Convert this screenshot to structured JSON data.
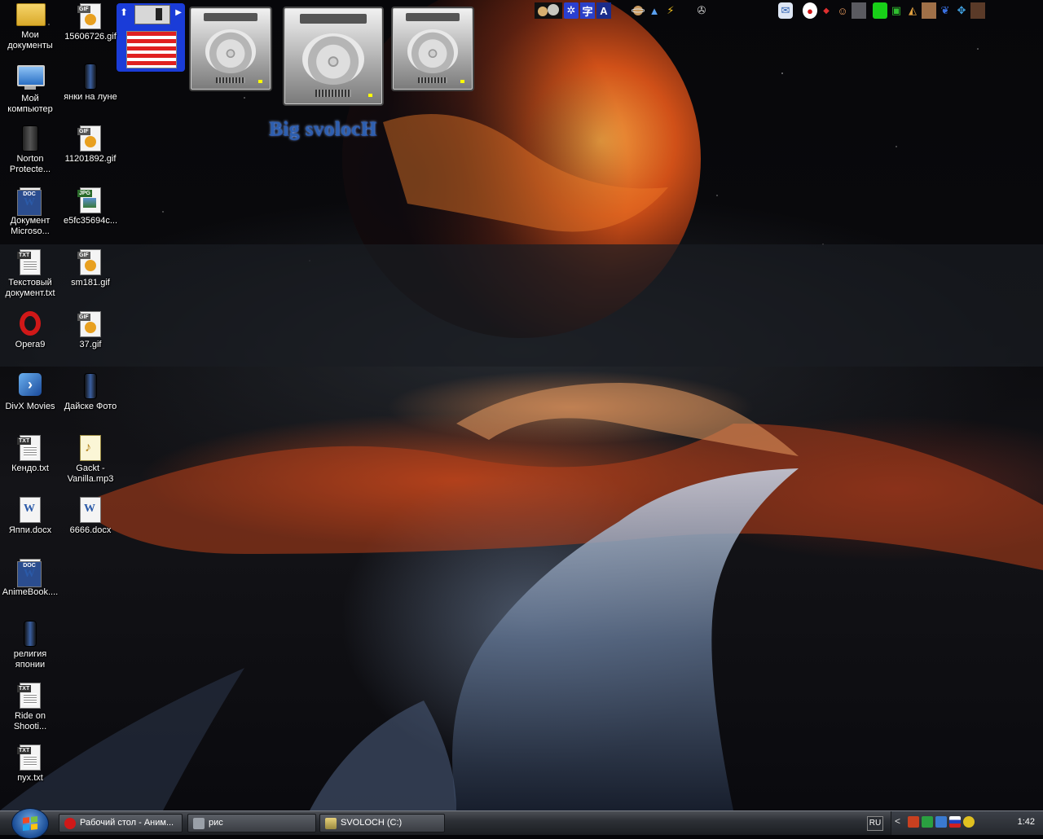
{
  "desktop": {
    "overlay_text": "Big svolocH",
    "column1": [
      {
        "id": "my-documents",
        "label": "Мои документы"
      },
      {
        "id": "my-computer",
        "label": "Мой компьютер"
      },
      {
        "id": "norton",
        "label": "Norton Protecte..."
      },
      {
        "id": "doc-microsoft",
        "label": "Документ Microso..."
      },
      {
        "id": "text-doc",
        "label": "Текстовый документ.txt"
      },
      {
        "id": "opera",
        "label": "Opera9"
      },
      {
        "id": "divx",
        "label": "DivX Movies"
      },
      {
        "id": "kendo",
        "label": "Кендо.txt"
      },
      {
        "id": "yappi",
        "label": "Яппи.docx"
      },
      {
        "id": "animebook",
        "label": "AnimeBook...."
      },
      {
        "id": "religion",
        "label": "религия японии"
      },
      {
        "id": "ride-on",
        "label": "Ride on Shooti..."
      },
      {
        "id": "pukh",
        "label": "пух.txt"
      }
    ],
    "column2": [
      {
        "id": "gif-15606726",
        "label": "15606726.gif"
      },
      {
        "id": "yanki",
        "label": "янки на луне"
      },
      {
        "id": "gif-11201892",
        "label": "11201892.gif"
      },
      {
        "id": "jpg-e5fc",
        "label": "e5fc35694c..."
      },
      {
        "id": "gif-sm181",
        "label": "sm181.gif"
      },
      {
        "id": "gif-37",
        "label": "37.gif"
      },
      {
        "id": "daiske",
        "label": "Дайске Фото"
      },
      {
        "id": "gackt",
        "label": "Gackt - Vanilla.mp3"
      },
      {
        "id": "docx-6666",
        "label": "6666.docx"
      }
    ],
    "top_tray_icon_names_left": [
      "planets-icon",
      "globe-icon",
      "kanji-icon",
      "translate-icon",
      "planet-icon",
      "triangle-icon",
      "flash-icon",
      "film-icon"
    ],
    "top_tray_icon_names_right": [
      "mail-icon",
      "red-circle-icon",
      "120-icon",
      "people-icon",
      "grid-icon",
      "green-icon",
      "monitor-icon",
      "pizza-icon",
      "photo-icon",
      "blue-bird-icon",
      "butterfly-icon",
      "portrait-icon"
    ],
    "kanji_glyph": "字",
    "translate_glyph": "A"
  },
  "taskbar": {
    "tasks": [
      {
        "label": "Рабочий стол - Аним...",
        "icon": "opera-icon"
      },
      {
        "label": "рис",
        "icon": "camera-icon"
      },
      {
        "label": "SVOLOCH (C:)",
        "icon": "drive-icon"
      }
    ],
    "language": "RU",
    "tray_arrow": "<",
    "clock": "1:42"
  },
  "colors": {
    "taskbar": "#2d3036",
    "overlay_text": "#2d5fb0",
    "floppy": "#1a3cd8"
  }
}
